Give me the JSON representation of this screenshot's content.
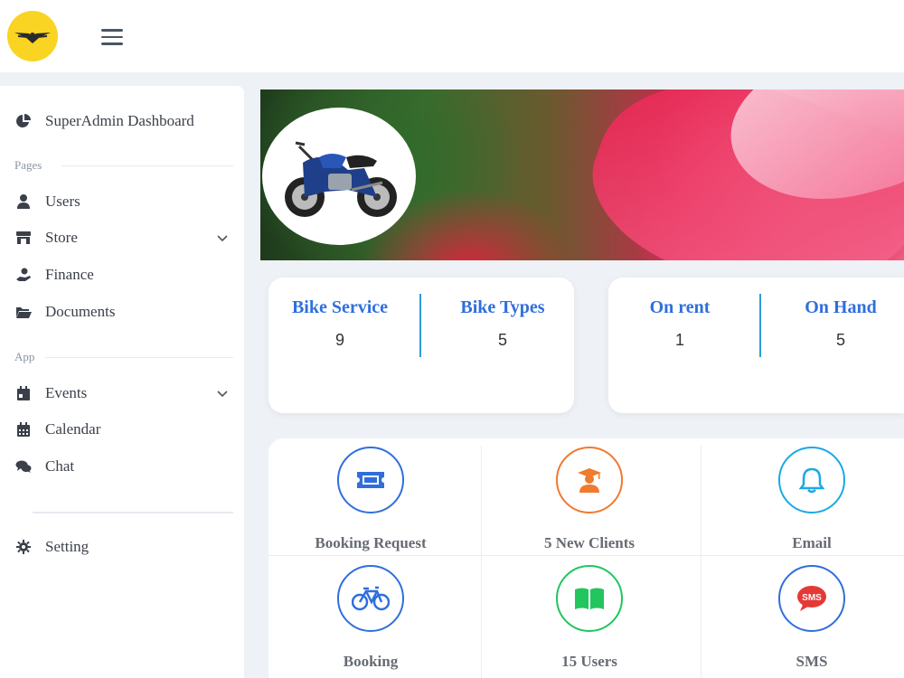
{
  "sidebar": {
    "dashboard": "SuperAdmin Dashboard",
    "section_pages": "Pages",
    "users": "Users",
    "store": "Store",
    "finance": "Finance",
    "documents": "Documents",
    "section_app": "App",
    "events": "Events",
    "calendar": "Calendar",
    "chat": "Chat",
    "setting": "Setting"
  },
  "stats": {
    "bike_service_label": "Bike Service",
    "bike_service_value": "9",
    "bike_types_label": "Bike Types",
    "bike_types_value": "5",
    "on_rent_label": "On rent",
    "on_rent_value": "1",
    "on_hand_label": "On Hand",
    "on_hand_value": "5"
  },
  "actions": {
    "booking_request": "Booking Request",
    "new_clients": "5 New Clients",
    "email": "Email",
    "booking": "Booking",
    "users": "15 Users",
    "sms": "SMS"
  },
  "icons": {
    "sms_badge": "SMS"
  },
  "colors": {
    "accent_blue": "#2f6fdc",
    "orange": "#f07a2e",
    "cyan": "#1aa9e6",
    "green": "#22c55e",
    "red": "#e53935",
    "logo_yellow": "#f9d423"
  }
}
